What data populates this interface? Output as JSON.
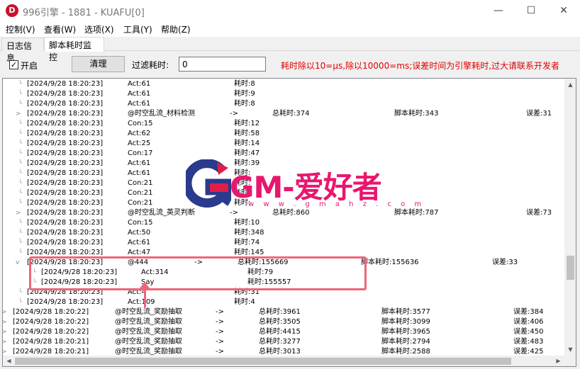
{
  "window": {
    "title": "996引擎 - 1881 - KUAFU[0]",
    "icon_letter": "D",
    "buttons": {
      "minimize": "—",
      "maximize": "☐",
      "close": "✕"
    }
  },
  "menu": {
    "items": [
      "控制(V)",
      "查看(W)",
      "选项(X)",
      "工具(Y)",
      "帮助(Z)"
    ]
  },
  "tabs": [
    {
      "label": "日志信息",
      "active": false
    },
    {
      "label": "脚本耗时监控",
      "active": true
    }
  ],
  "toolbar": {
    "enable_label": "开启",
    "enable_checked": true,
    "clear_label": "清理",
    "filter_label": "过滤耗时:",
    "filter_value": "0",
    "note": "耗时除以10=μs,除以10000=ms;误差时间为引擎耗时,过大请联系开发者"
  },
  "tree": {
    "rows": [
      {
        "level": 1,
        "toggle": "",
        "ts": "[2024/9/28 18:20:23]",
        "name": "Act:61",
        "arrow": "",
        "total": "耗时:8",
        "script": "",
        "error": ""
      },
      {
        "level": 1,
        "toggle": "",
        "ts": "[2024/9/28 18:20:23]",
        "name": "Act:61",
        "arrow": "",
        "total": "耗时:9",
        "script": "",
        "error": ""
      },
      {
        "level": 1,
        "toggle": "",
        "ts": "[2024/9/28 18:20:23]",
        "name": "Act:61",
        "arrow": "",
        "total": "耗时:8",
        "script": "",
        "error": ""
      },
      {
        "level": 1,
        "toggle": ">",
        "ts": "[2024/9/28 18:20:23]",
        "name": "@时空乱流_材料检测",
        "arrow": "->",
        "total": "总耗时:374",
        "script": "脚本耗时:343",
        "error": "误差:31"
      },
      {
        "level": 1,
        "toggle": "",
        "ts": "[2024/9/28 18:20:23]",
        "name": "Con:15",
        "arrow": "",
        "total": "耗时:12",
        "script": "",
        "error": ""
      },
      {
        "level": 1,
        "toggle": "",
        "ts": "[2024/9/28 18:20:23]",
        "name": "Act:62",
        "arrow": "",
        "total": "耗时:58",
        "script": "",
        "error": ""
      },
      {
        "level": 1,
        "toggle": "",
        "ts": "[2024/9/28 18:20:23]",
        "name": "Act:25",
        "arrow": "",
        "total": "耗时:14",
        "script": "",
        "error": ""
      },
      {
        "level": 1,
        "toggle": "",
        "ts": "[2024/9/28 18:20:23]",
        "name": "Con:17",
        "arrow": "",
        "total": "耗时:47",
        "script": "",
        "error": ""
      },
      {
        "level": 1,
        "toggle": "",
        "ts": "[2024/9/28 18:20:23]",
        "name": "Act:61",
        "arrow": "",
        "total": "耗时:39",
        "script": "",
        "error": ""
      },
      {
        "level": 1,
        "toggle": "",
        "ts": "[2024/9/28 18:20:23]",
        "name": "Act:61",
        "arrow": "",
        "total": "耗时:",
        "script": "",
        "error": ""
      },
      {
        "level": 1,
        "toggle": "",
        "ts": "[2024/9/28 18:20:23]",
        "name": "Con:21",
        "arrow": "",
        "total": "耗时:",
        "script": "",
        "error": ""
      },
      {
        "level": 1,
        "toggle": "",
        "ts": "[2024/9/28 18:20:23]",
        "name": "Con:21",
        "arrow": "",
        "total": "耗时:",
        "script": "",
        "error": ""
      },
      {
        "level": 1,
        "toggle": "",
        "ts": "[2024/9/28 18:20:23]",
        "name": "Con:21",
        "arrow": "",
        "total": "耗时:",
        "script": "",
        "error": ""
      },
      {
        "level": 1,
        "toggle": ">",
        "ts": "[2024/9/28 18:20:23]",
        "name": "@时空乱流_英灵判断",
        "arrow": "->",
        "total": "总耗时:860",
        "script": "脚本耗时:787",
        "error": "误差:73"
      },
      {
        "level": 1,
        "toggle": "",
        "ts": "[2024/9/28 18:20:23]",
        "name": "Con:15",
        "arrow": "",
        "total": "耗时:10",
        "script": "",
        "error": ""
      },
      {
        "level": 1,
        "toggle": "",
        "ts": "[2024/9/28 18:20:23]",
        "name": "Act:50",
        "arrow": "",
        "total": "耗时:348",
        "script": "",
        "error": ""
      },
      {
        "level": 1,
        "toggle": "",
        "ts": "[2024/9/28 18:20:23]",
        "name": "Act:61",
        "arrow": "",
        "total": "耗时:74",
        "script": "",
        "error": ""
      },
      {
        "level": 1,
        "toggle": "",
        "ts": "[2024/9/28 18:20:23]",
        "name": "Act:47",
        "arrow": "",
        "total": "耗时:145",
        "script": "",
        "error": ""
      },
      {
        "level": 1,
        "toggle": "v",
        "ts": "[2024/9/28 18:20:23]",
        "name": "@444",
        "arrow": "->",
        "total": "总耗时:155669",
        "script": "脚本耗时:155636",
        "error": "误差:33"
      },
      {
        "level": 2,
        "toggle": "",
        "ts": "[2024/9/28 18:20:23]",
        "name": "Act:314",
        "arrow": "",
        "total": "耗时:79",
        "script": "",
        "error": ""
      },
      {
        "level": 2,
        "toggle": "",
        "ts": "[2024/9/28 18:20:23]",
        "name": "Say",
        "arrow": "",
        "total": "耗时:155557",
        "script": "",
        "error": ""
      },
      {
        "level": 1,
        "toggle": "",
        "ts": "[2024/9/28 18:20:23]",
        "name": "Act:4",
        "arrow": "",
        "total": "耗时:31",
        "script": "",
        "error": ""
      },
      {
        "level": 1,
        "toggle": "",
        "ts": "[2024/9/28 18:20:23]",
        "name": "Act:109",
        "arrow": "",
        "total": "耗时:4",
        "script": "",
        "error": ""
      },
      {
        "level": 0,
        "toggle": ">",
        "ts": "[2024/9/28 18:20:22]",
        "name": "@时空乱流_奖励抽取",
        "arrow": "->",
        "total": "总耗时:3961",
        "script": "脚本耗时:3577",
        "error": "误差:384"
      },
      {
        "level": 0,
        "toggle": ">",
        "ts": "[2024/9/28 18:20:22]",
        "name": "@时空乱流_奖励抽取",
        "arrow": "->",
        "total": "总耗时:3505",
        "script": "脚本耗时:3099",
        "error": "误差:406"
      },
      {
        "level": 0,
        "toggle": ">",
        "ts": "[2024/9/28 18:20:22]",
        "name": "@时空乱流_奖励抽取",
        "arrow": "->",
        "total": "总耗时:4415",
        "script": "脚本耗时:3965",
        "error": "误差:450"
      },
      {
        "level": 0,
        "toggle": ">",
        "ts": "[2024/9/28 18:20:21]",
        "name": "@时空乱流_奖励抽取",
        "arrow": "->",
        "total": "总耗时:3277",
        "script": "脚本耗时:2794",
        "error": "误差:483"
      },
      {
        "level": 0,
        "toggle": ">",
        "ts": "[2024/9/28 18:20:21]",
        "name": "@时空乱流_奖励抽取",
        "arrow": "->",
        "total": "总耗时:3013",
        "script": "脚本耗时:2588",
        "error": "误差:425"
      }
    ]
  },
  "scrollbar": {
    "up": "▲",
    "down": "▼",
    "left": "◀",
    "right": "▶"
  },
  "watermark": {
    "text": "GM-爱好者",
    "url": "w w w . g m a h z . c o m",
    "colors": {
      "accent": "#e8176e",
      "g_blue": "#2a3a8c",
      "g_red": "#e11d48"
    }
  },
  "highlight_color": "#f06478"
}
